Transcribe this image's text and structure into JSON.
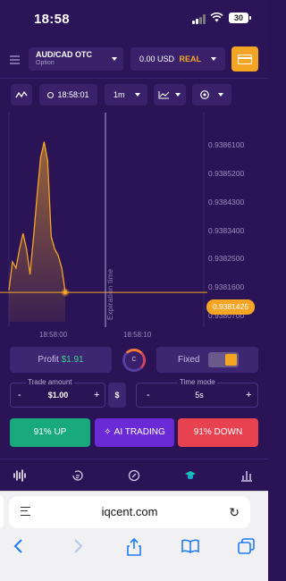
{
  "status_bar": {
    "time": "18:58",
    "battery": "30"
  },
  "header": {
    "asset": {
      "name": "AUD/CAD OTC",
      "type": "Option"
    },
    "balance": {
      "amount": "0.00 USD",
      "mode": "REAL"
    }
  },
  "toolbar": {
    "time": "18:58:01",
    "interval": "1m"
  },
  "chart_data": {
    "type": "area",
    "title": "",
    "y_ticks": [
      "0.9386100",
      "0.9385200",
      "0.9384300",
      "0.9383400",
      "0.9382500",
      "0.9381600",
      "0.9380700"
    ],
    "ylim": [
      0.93805,
      0.93865
    ],
    "x_ticks": [
      "18:58:00",
      "18:58:10"
    ],
    "current_price": "0.9381425",
    "expiration_label": "Expiration time",
    "series": [
      {
        "values": [
          0.93815,
          0.93824,
          0.93822,
          0.93828,
          0.93833,
          0.93828,
          0.9382,
          0.93832,
          0.93845,
          0.93857,
          0.93862,
          0.93856,
          0.93832,
          0.93828,
          0.93826,
          0.93822,
          0.938143
        ]
      }
    ],
    "line_color": "#f5a524"
  },
  "controls": {
    "profit_label": "Profit",
    "profit_value": "$1.91",
    "timer_letter": "C",
    "fixed_label": "Fixed",
    "trade_amount_label": "Trade amount",
    "trade_amount_value": "$1.00",
    "currency_symbol": "$",
    "time_label": "Time mode",
    "time_value": "5s",
    "minus": "-",
    "plus": "+"
  },
  "buttons": {
    "up": "91% UP",
    "ai": "AI TRADING",
    "down": "91% DOWN"
  },
  "safari": {
    "url": "iqcent.com"
  }
}
